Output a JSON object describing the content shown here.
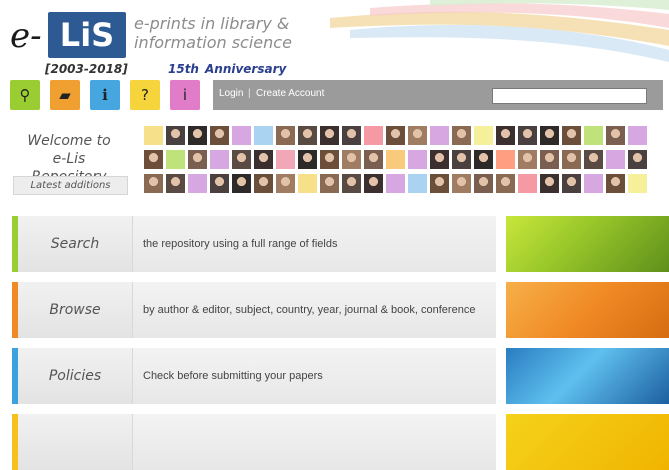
{
  "header": {
    "logo_e": "e-",
    "logo_box": "LiS",
    "years": "[2003-2018]",
    "tagline_line1": "e-prints in library &",
    "tagline_line2": "information science",
    "anniv_number": "15th",
    "anniv_word": "Anniversary"
  },
  "toolbar": {
    "icons": [
      {
        "name": "search-icon",
        "glyph": "⚲",
        "color": "#9acd32"
      },
      {
        "name": "folder-icon",
        "glyph": "▰",
        "color": "#f0a030"
      },
      {
        "name": "info-pin-icon",
        "glyph": "ℹ",
        "color": "#45a6e0"
      },
      {
        "name": "help-icon",
        "glyph": "?",
        "color": "#f5d43c"
      },
      {
        "name": "about-icon",
        "glyph": "i",
        "color": "#e07cc8"
      }
    ],
    "login": "Login",
    "create_account": "Create Account"
  },
  "welcome": {
    "line1": "Welcome to",
    "line2": "e-Lis Repository",
    "latest": "Latest additions"
  },
  "features": [
    {
      "label": "Search",
      "desc": "the repository using a full range of fields",
      "color": "#9acd32"
    },
    {
      "label": "Browse",
      "desc": "by author & editor, subject, country, year, journal & book, conference",
      "color": "#f08a24"
    },
    {
      "label": "Policies",
      "desc": "Check before submitting your papers",
      "color": "#3aa3de"
    },
    {
      "label": "",
      "desc": "",
      "color": "#f5c21b"
    }
  ]
}
